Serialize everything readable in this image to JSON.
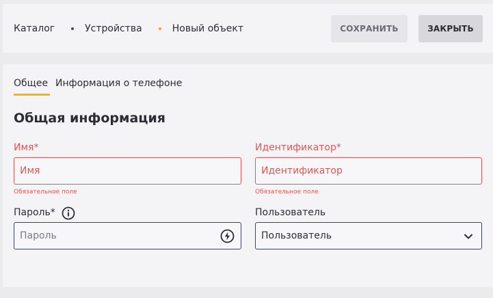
{
  "breadcrumb": {
    "items": [
      "Каталог",
      "Устройства",
      "Новый объект"
    ]
  },
  "toolbar": {
    "save_label": "СОХРАНИТЬ",
    "close_label": "ЗАКРЫТЬ"
  },
  "tabs": [
    {
      "label": "Общее",
      "active": true
    },
    {
      "label": "Информация о телефоне",
      "active": false
    }
  ],
  "form": {
    "section_title": "Общая информация",
    "name": {
      "label": "Имя*",
      "placeholder": "Имя",
      "value": "",
      "error": "Обязательное поле"
    },
    "identifier": {
      "label": "Идентификатор*",
      "placeholder": "Идентификатор",
      "value": "",
      "error": "Обязательное поле"
    },
    "password": {
      "label": "Пароль*",
      "placeholder": "Пароль",
      "value": ""
    },
    "user": {
      "label": "Пользователь",
      "selected": "Пользователь"
    }
  },
  "colors": {
    "accent": "#f5b800",
    "error": "#e05555",
    "field_border": "#3a4468"
  },
  "icons": [
    "info-icon",
    "bolt-icon",
    "chevron-down-icon"
  ]
}
